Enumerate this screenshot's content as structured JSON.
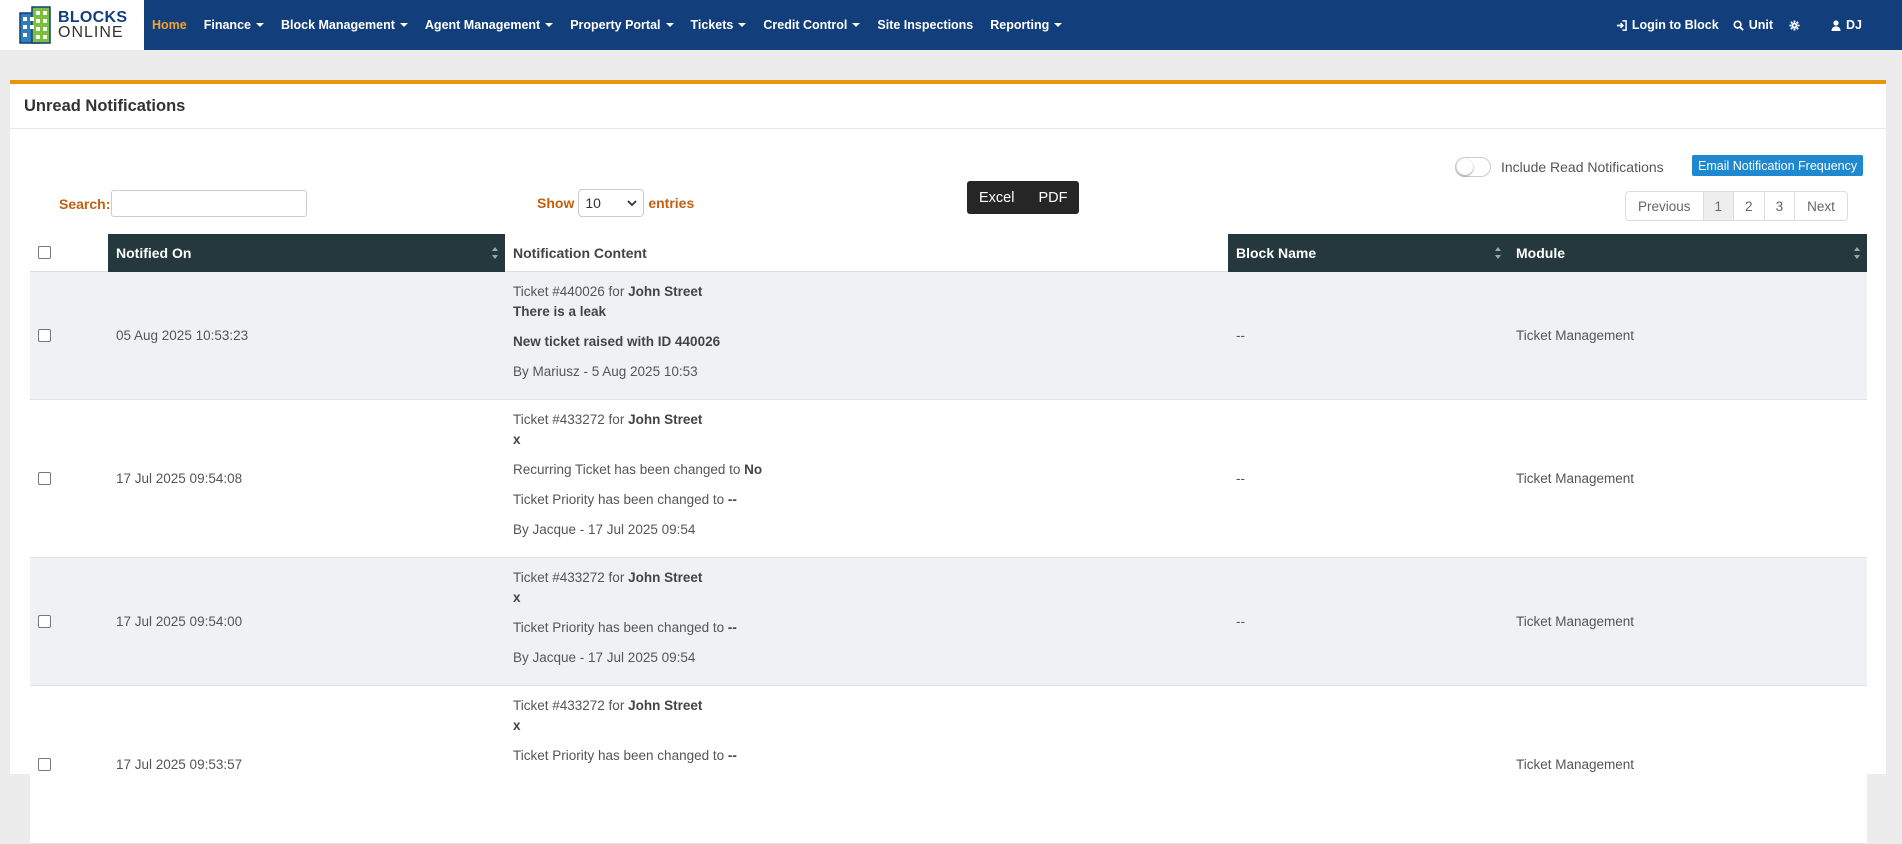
{
  "brand": {
    "line1": "BLOCKS",
    "line2": "ONLINE"
  },
  "nav": {
    "items": [
      {
        "label": "Home",
        "active": true,
        "dropdown": false
      },
      {
        "label": "Finance",
        "active": false,
        "dropdown": true
      },
      {
        "label": "Block Management",
        "active": false,
        "dropdown": true
      },
      {
        "label": "Agent Management",
        "active": false,
        "dropdown": true
      },
      {
        "label": "Property Portal",
        "active": false,
        "dropdown": true
      },
      {
        "label": "Tickets",
        "active": false,
        "dropdown": true
      },
      {
        "label": "Credit Control",
        "active": false,
        "dropdown": true
      },
      {
        "label": "Site Inspections",
        "active": false,
        "dropdown": false
      },
      {
        "label": "Reporting",
        "active": false,
        "dropdown": true
      }
    ],
    "right": {
      "login_label": "Login to Block",
      "unit_label": "Unit",
      "user_initials": "DJ"
    }
  },
  "panel": {
    "title": "Unread Notifications",
    "include_read_label": "Include Read Notifications",
    "include_read_on": false,
    "email_btn_label": "Email Notification Frequency",
    "search_label": "Search:",
    "search_value": "",
    "show_label": "Show",
    "show_value": "10",
    "entries_label": "entries",
    "export": {
      "excel": "Excel",
      "pdf": "PDF"
    },
    "pager": {
      "previous": "Previous",
      "pages": [
        "1",
        "2",
        "3"
      ],
      "current": "1",
      "next": "Next"
    }
  },
  "table": {
    "headers": {
      "notified_on": "Notified On",
      "content": "Notification Content",
      "block": "Block Name",
      "module": "Module"
    },
    "rows": [
      {
        "date": "05 Aug 2025 10:53:23",
        "block": "--",
        "module": "Ticket Management",
        "ticket_prefix": "Ticket #440026 for ",
        "ticket_street": "John Street",
        "subject": "There is a leak",
        "change1_text": "New ticket raised with ID 440026",
        "by": "By Mariusz - 5 Aug 2025 10:53"
      },
      {
        "date": "17 Jul 2025 09:54:08",
        "block": "--",
        "module": "Ticket Management",
        "ticket_prefix": "Ticket #433272 for ",
        "ticket_street": "John Street",
        "subject": "x",
        "change1_text": "Recurring Ticket has been changed to ",
        "change1_value": "No",
        "change2_text": "Ticket Priority has been changed to ",
        "change2_value": "--",
        "by": "By Jacque - 17 Jul 2025 09:54"
      },
      {
        "date": "17 Jul 2025 09:54:00",
        "block": "--",
        "module": "Ticket Management",
        "ticket_prefix": "Ticket #433272 for ",
        "ticket_street": "John Street",
        "subject": "x",
        "change1_text": "Ticket Priority has been changed to ",
        "change1_value": "--",
        "by": "By Jacque - 17 Jul 2025 09:54"
      },
      {
        "date": "17 Jul 2025 09:53:57",
        "block": "",
        "module": "Ticket Management",
        "ticket_prefix": "Ticket #433272 for ",
        "ticket_street": "John Street",
        "subject": "x",
        "change1_text": "Ticket Priority has been changed to ",
        "change1_value": "--"
      }
    ]
  },
  "colors": {
    "navbar": "#123f7c",
    "accent": "#e8950d",
    "active_nav": "#f0a330",
    "header_dark": "#25383e",
    "email_btn": "#1e88d0"
  }
}
